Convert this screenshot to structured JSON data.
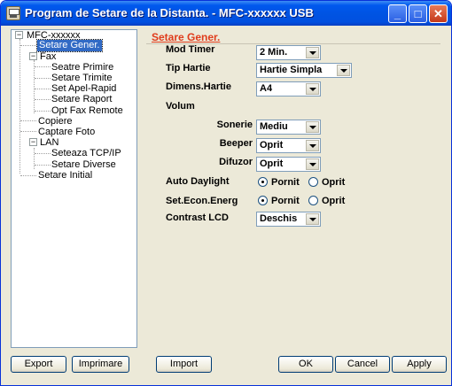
{
  "window": {
    "title": "Program de Setare de la Distanta. - MFC-xxxxxx USB"
  },
  "titlebar_buttons": {
    "minimize": "_",
    "maximize": "□",
    "close": "✕"
  },
  "tree": {
    "root": "MFC-xxxxxx",
    "nodes": {
      "setare_gener": "Setare Gener.",
      "fax": "Fax",
      "seatre_primire": "Seatre Primire",
      "setare_trimite": "Setare Trimite",
      "set_apel_rapid": "Set Apel-Rapid",
      "setare_raport": "Setare Raport",
      "opt_fax_remote": "Opt Fax Remote",
      "copiere": "Copiere",
      "captare_foto": "Captare Foto",
      "lan": "LAN",
      "seteaza_tcpip": "Seteaza TCP/IP",
      "setare_diverse": "Setare Diverse",
      "setare_initial": "Setare Initial"
    },
    "expander_minus": "−"
  },
  "panel": {
    "title": "Setare Gener.",
    "mod_timer": {
      "label": "Mod Timer",
      "value": "2 Min."
    },
    "tip_hartie": {
      "label": "Tip Hartie",
      "value": "Hartie Simpla"
    },
    "dimens_hartie": {
      "label": "Dimens.Hartie",
      "value": "A4"
    },
    "volum": {
      "label": "Volum"
    },
    "sonerie": {
      "label": "Sonerie",
      "value": "Mediu"
    },
    "beeper": {
      "label": "Beeper",
      "value": "Oprit"
    },
    "difuzor": {
      "label": "Difuzor",
      "value": "Oprit"
    },
    "auto_daylight": {
      "label": "Auto Daylight",
      "on": "Pornit",
      "off": "Oprit"
    },
    "set_econ": {
      "label": "Set.Econ.Energ",
      "on": "Pornit",
      "off": "Oprit"
    },
    "contrast_lcd": {
      "label": "Contrast LCD",
      "value": "Deschis"
    }
  },
  "buttons": {
    "export": "Export",
    "imprimare": "Imprimare",
    "import": "Import",
    "ok": "OK",
    "cancel": "Cancel",
    "apply": "Apply"
  }
}
